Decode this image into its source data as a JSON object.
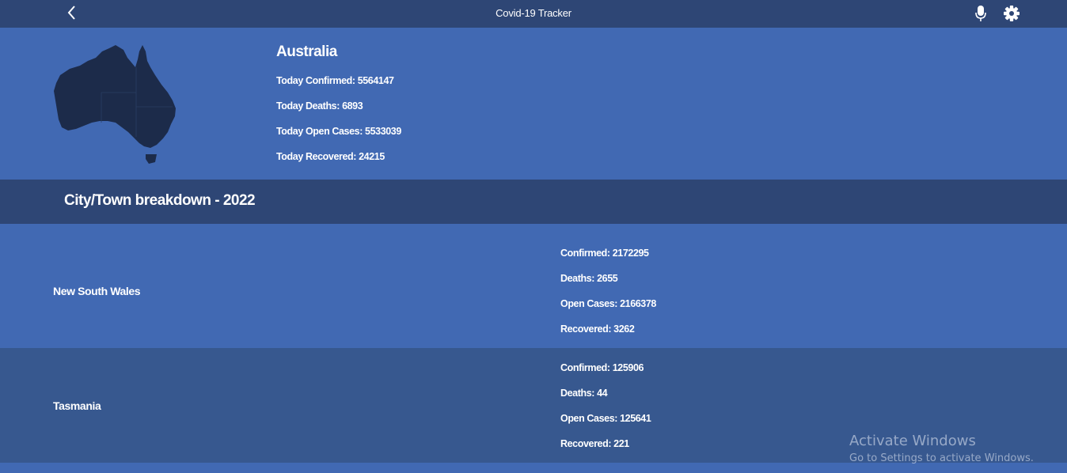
{
  "header": {
    "title": "Covid-19 Tracker",
    "back_icon": "chevron-left-icon",
    "mic_icon": "microphone-icon",
    "settings_icon": "gear-icon"
  },
  "summary": {
    "country": "Australia",
    "confirmed": "Today Confirmed: 5564147",
    "deaths": "Today Deaths: 6893",
    "open_cases": "Today Open Cases: 5533039",
    "recovered": "Today Recovered: 24215",
    "map_icon": "australia-map-icon"
  },
  "breakdown": {
    "title": "City/Town breakdown - 2022",
    "regions": [
      {
        "name": "New South Wales",
        "confirmed": "Confirmed: 2172295",
        "deaths": "Deaths: 2655",
        "open_cases": "Open Cases: 2166378",
        "recovered": "Recovered: 3262"
      },
      {
        "name": "Tasmania",
        "confirmed": "Confirmed: 125906",
        "deaths": "Deaths: 44",
        "open_cases": "Open Cases: 125641",
        "recovered": "Recovered: 221"
      }
    ]
  },
  "watermark": {
    "title": "Activate Windows",
    "subtitle": "Go to Settings to activate Windows."
  },
  "colors": {
    "header_bg": "#2e4675",
    "panel_bg": "#4169b3",
    "alt_row_bg": "#37588f",
    "map_fill": "#1c2b4a"
  }
}
